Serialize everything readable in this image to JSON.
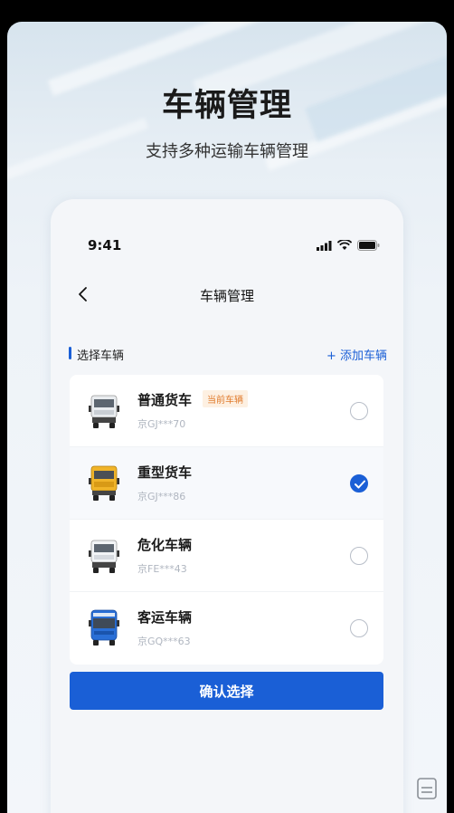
{
  "hero": {
    "title": "车辆管理",
    "subtitle": "支持多种运输车辆管理"
  },
  "status_bar": {
    "time": "9:41",
    "icons": [
      "signal-icon",
      "wifi-icon",
      "battery-icon"
    ]
  },
  "navbar": {
    "back_icon": "chevron-left-icon",
    "title": "车辆管理"
  },
  "section": {
    "label": "选择车辆",
    "add_label": "+ 添加车辆"
  },
  "vehicles": [
    {
      "name": "普通货车",
      "tag": "当前车辆",
      "plate": "京GJ***70",
      "icon": "white-truck-icon",
      "selected": false
    },
    {
      "name": "重型货车",
      "tag": "",
      "plate": "京GJ***86",
      "icon": "yellow-truck-icon",
      "selected": true
    },
    {
      "name": "危化车辆",
      "tag": "",
      "plate": "京FE***43",
      "icon": "white-truck-icon",
      "selected": false
    },
    {
      "name": "客运车辆",
      "tag": "",
      "plate": "京GQ***63",
      "icon": "blue-bus-icon",
      "selected": false
    }
  ],
  "confirm_label": "确认选择",
  "colors": {
    "accent": "#1a5fd6",
    "tag_text": "#e07a2b",
    "tag_bg": "#fdf0e2"
  }
}
